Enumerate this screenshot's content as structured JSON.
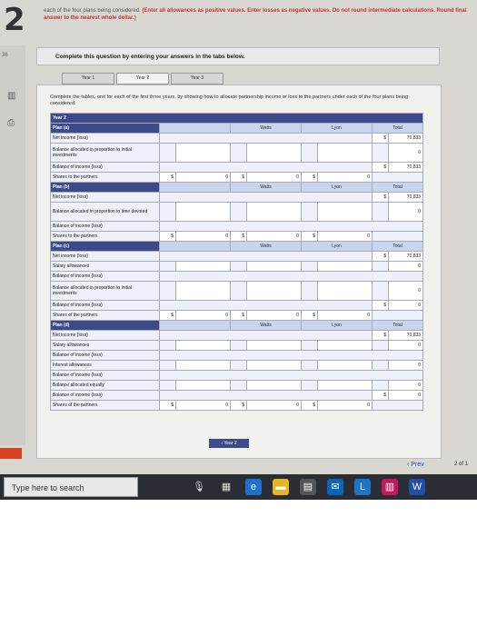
{
  "page_number": "2",
  "intro": {
    "line1": "each of the four plans being considered.",
    "line1_red": "(Enter all allowances as positive values. Enter losses as negative values. Do not round intermediate calculations. Round final answer to the nearest whole dollar.)"
  },
  "instruction": "Complete this question by entering your answers in the tabs below.",
  "tabs": [
    "Year 1",
    "Year 2",
    "Year 3"
  ],
  "panel_instruction": "Complete the tables, one for each of the first three years, by showing how to allocate partnership income or loss to the partners under each of the four plans being considered.",
  "year_label": "Year 2",
  "cols": {
    "watts": "Watts",
    "lyon": "Lyon",
    "total": "Total"
  },
  "plans": {
    "a": "Plan (a)",
    "b": "Plan (b)",
    "c": "Plan (c)",
    "d": "Plan (d)"
  },
  "rows": {
    "net_income": "Net income (loss)",
    "bal_alloc_initial": "Balance allocated in proportion to initial investments",
    "bal_income": "Balance of income (loss)",
    "shares": "Shares to the partners",
    "bal_alloc_time": "Balance allocated in proportion to time devoted",
    "salary": "Salary allowances",
    "shares_of": "Shares of the partners",
    "interest": "Interest allowances",
    "bal_equally": "Balance allocated equally"
  },
  "values": {
    "total": "70,833",
    "zero": "0",
    "dollar": "$"
  },
  "year_nav": "‹ Year 2",
  "nav": {
    "prev": "‹ Prev",
    "pager": "2 of 1"
  },
  "taskbar": {
    "search_placeholder": "Type here to search"
  },
  "left_rail": {
    "num": "36",
    "label_points": "ints",
    "label_ebook": "eBook",
    "label_print": "Print"
  }
}
